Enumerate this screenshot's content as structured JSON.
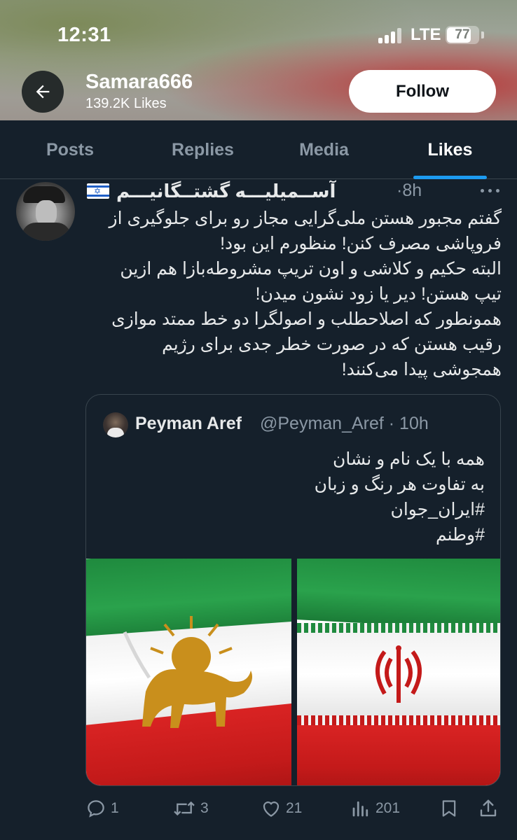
{
  "status_bar": {
    "time": "12:31",
    "network": "LTE",
    "battery_level": "77"
  },
  "profile": {
    "name": "Samara666",
    "likes": "139.2K Likes",
    "follow_label": "Follow"
  },
  "tabs": [
    {
      "label": "Posts",
      "active": false
    },
    {
      "label": "Replies",
      "active": false
    },
    {
      "label": "Media",
      "active": false
    },
    {
      "label": "Likes",
      "active": true
    }
  ],
  "tweet": {
    "author": "آســمیلیـــه گشتــگانیـــم",
    "flag": "🇮🇱",
    "time": "·8h",
    "text_lines": [
      "گفتم مجبور هستن ملی‌گرایی مجاز رو برای جلوگیری از",
      "فروپاشی مصرف کنن! منظورم این بود!",
      "البته حکیم و کلاشی و اون تریپ مشروطه‌بازا هم ازین",
      "تیپ هستن! دیر یا زود نشون میدن!",
      "همونطور که اصلاحطلب و اصولگرا دو خط ممتد موازی",
      "رقیب هستن که در صورت خطر جدی برای رژیم",
      "همجوشی پیدا می‌کنند!"
    ],
    "quote": {
      "name": "Peyman Aref",
      "handle": "@Peyman_Aref · 10h",
      "text_lines": [
        "همه با یک نام و نشان",
        "به تفاوت هر رنگ و زبان",
        "#ایران_جوان",
        "#وطنم"
      ]
    },
    "stats": {
      "replies": "1",
      "retweets": "3",
      "likes": "21",
      "views": "201"
    }
  },
  "colors": {
    "background": "#15202b",
    "accent": "#1d9bf0",
    "muted": "#8b98a5",
    "border": "#38444d"
  }
}
